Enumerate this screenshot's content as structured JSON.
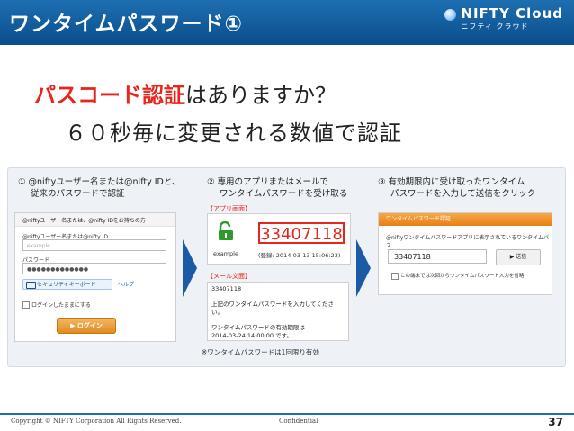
{
  "header": {
    "title": "ワンタイムパスワード①",
    "logo_brand": "NIFTY Cloud",
    "logo_sub": "ニフティ クラウド"
  },
  "question": {
    "highlight": "パスコード認証",
    "rest": "はありますか？"
  },
  "answer": "６０秒毎に変更される数値で認証",
  "steps": {
    "s1_line1": "①  @niftyユーザー名または@nifty IDと、",
    "s1_line2": "従来のパスワードで認証",
    "s2_line1": "②  専用のアプリまたはメールで",
    "s2_line2": "ワンタイムパスワードを受け取る",
    "s3_line1": "③  有効期限内に受け取ったワンタイム",
    "s3_line2": "パスワードを入力して送信をクリック"
  },
  "login": {
    "header": "@niftyユーザー名または、@nifty IDをお持ちの方",
    "user_label": "@niftyユーザー名または@nifty ID",
    "user_placeholder": "example",
    "password_label": "パスワード",
    "password_value": "●●●●●●●●●●●●●",
    "security_button": "セキュリティキーボード",
    "help_link": "ヘルプ",
    "remember_label": "ログインしたままにする",
    "login_button": "ログイン"
  },
  "app": {
    "tag": "【アプリ画面】",
    "code": "33407118",
    "account": "example",
    "registered": "(登録: 2014-03-13 15:06:23)"
  },
  "mail": {
    "tag": "【メール文面】",
    "line1": "33407118",
    "line2": "上記のワンタイムパスワードを入力してください。",
    "line3": "ワンタイムパスワードの有効期限は",
    "line4": "2014-03-24 14:00:00 です。"
  },
  "onetime_note": "※ワンタイムパスワードは1回限り有効",
  "input": {
    "bar": "ワンタイムパスワード認証",
    "desc": "@niftyワンタイムパスワードアプリに表示されているワンタイムパス",
    "value": "33407118",
    "send_button": "▶ 送信",
    "remember_note": "この端末では次回からワンタイムパスワード入力を省略"
  },
  "footer": {
    "copyright": "Copyright © NIFTY Corporation All Rights Reserved.",
    "confidential": "Confidential",
    "page": "37"
  },
  "colors": {
    "brand_blue": "#1d6fb1",
    "accent_red": "#e8251b",
    "app_green": "#2e9a2e"
  }
}
